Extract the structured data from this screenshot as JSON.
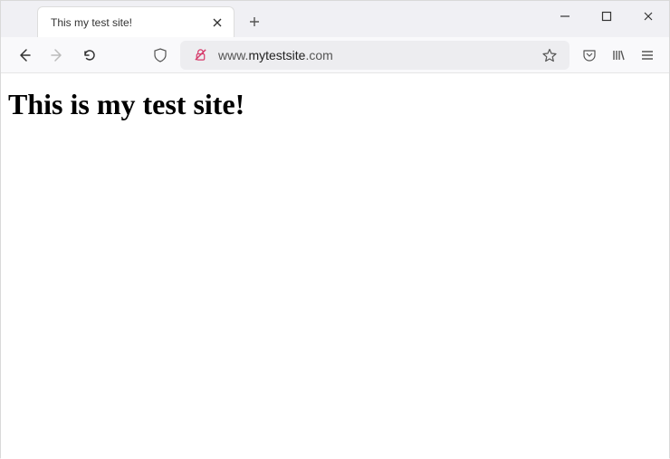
{
  "tab": {
    "title": "This my test site!"
  },
  "url": {
    "prefix": "www.",
    "domain": "mytestsite",
    "suffix": ".com"
  },
  "page": {
    "heading": "This is my test site!"
  }
}
